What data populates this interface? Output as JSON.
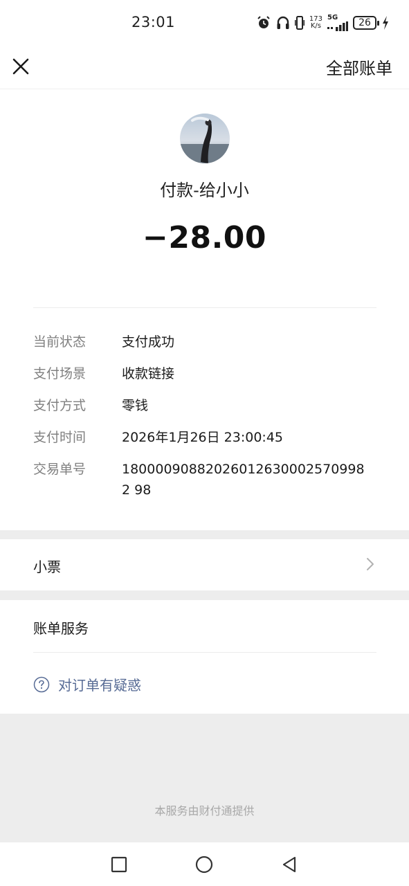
{
  "status_bar": {
    "time": "23:01",
    "net_speed_value": "173",
    "net_speed_unit": "K/s",
    "network_type": "5G",
    "battery_level": "26",
    "icons": [
      "alarm-icon",
      "headphones-icon",
      "vibrate-icon",
      "signal-icon",
      "battery-icon",
      "charging-icon"
    ]
  },
  "header": {
    "close_icon": "close-icon",
    "all_bills_label": "全部账单"
  },
  "summary": {
    "payee": "付款-给小小",
    "amount": "−28.00"
  },
  "details": [
    {
      "label": "当前状态",
      "value": "支付成功"
    },
    {
      "label": "支付场景",
      "value": "收款链接"
    },
    {
      "label": "支付方式",
      "value": "零钱"
    },
    {
      "label": "支付时间",
      "value": "2026年1月26日 23:00:45"
    },
    {
      "label": "交易单号",
      "value": "180000908820260126300025709982 98"
    }
  ],
  "receipt": {
    "label": "小票",
    "icon": "chevron-right-icon"
  },
  "services": {
    "title": "账单服务",
    "doubt_label": "对订单有疑惑",
    "doubt_icon": "question-circle-icon"
  },
  "footer": {
    "note": "本服务由财付通提供"
  },
  "nav_bar": {
    "icons": [
      "recent-apps-icon",
      "home-icon",
      "back-icon"
    ]
  },
  "colors": {
    "link": "#576b95",
    "label_gray": "#808080",
    "band_gray": "#ededed"
  }
}
